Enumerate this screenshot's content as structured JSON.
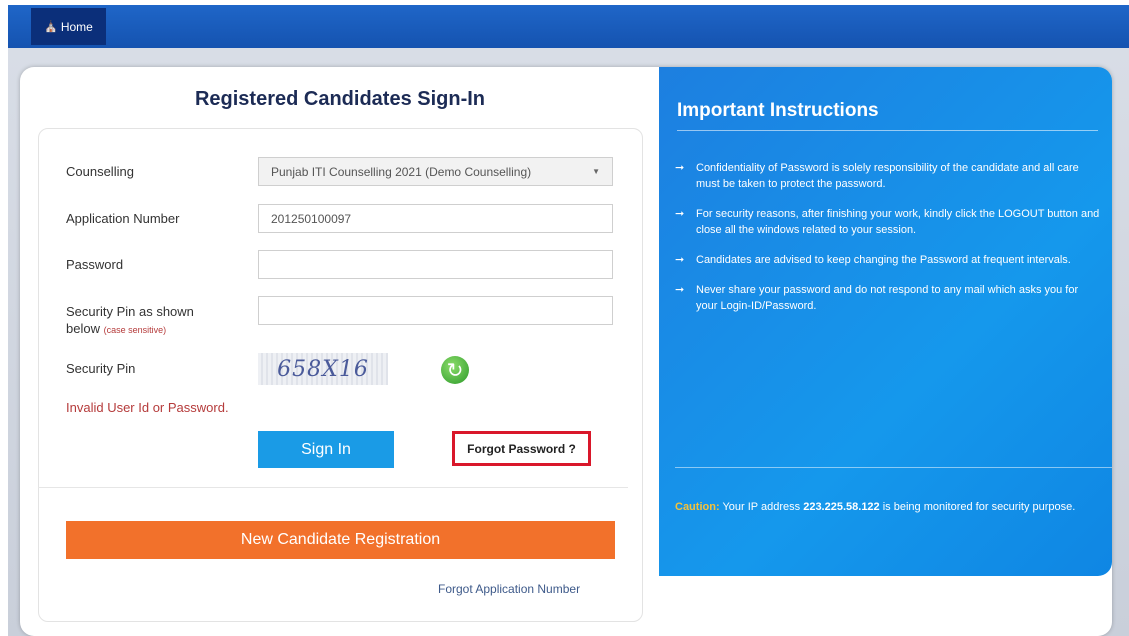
{
  "nav": {
    "home_label": "Home"
  },
  "signin": {
    "title": "Registered Candidates Sign-In",
    "counselling_label": "Counselling",
    "counselling_value": "Punjab ITI Counselling 2021 (Demo Counselling)",
    "application_label": "Application Number",
    "application_value": "201250100097",
    "password_label": "Password",
    "password_value": "",
    "secpin_label": "Security Pin as shown",
    "secpin_label_line2": "below",
    "secpin_note": "(case sensitive)",
    "secpin_value": "",
    "captcha_label": "Security Pin",
    "captcha_text": "658X16",
    "error_text": "Invalid User Id or Password.",
    "signin_button": "Sign In",
    "forgot_password": "Forgot Password ?",
    "register_button": "New Candidate Registration",
    "forgot_application": "Forgot Application Number"
  },
  "instructions": {
    "title": "Important Instructions",
    "items": [
      "Confidentiality of Password is solely responsibility of the candidate and all care must be taken to protect the password.",
      "For security reasons, after finishing your work, kindly click the LOGOUT button and close all the windows related to your session.",
      "Candidates are advised to keep changing the Password at frequent intervals.",
      "Never share your password and do not respond to any mail which asks you for your Login-ID/Password."
    ],
    "caution_label": "Caution:",
    "caution_text_1": " Your IP address ",
    "caution_ip": "223.225.58.122",
    "caution_text_2": " is being monitored for security purpose."
  },
  "colors": {
    "header_blue": "#1553b0",
    "signin_blue": "#1a9be6",
    "register_orange": "#f2712b",
    "error_red": "#b53b3b",
    "caution_yellow": "#f5c23a"
  },
  "icons": {
    "home": "home-icon",
    "refresh": "refresh-icon",
    "arrow": "arrow-right-icon",
    "dropdown": "chevron-down-icon"
  }
}
